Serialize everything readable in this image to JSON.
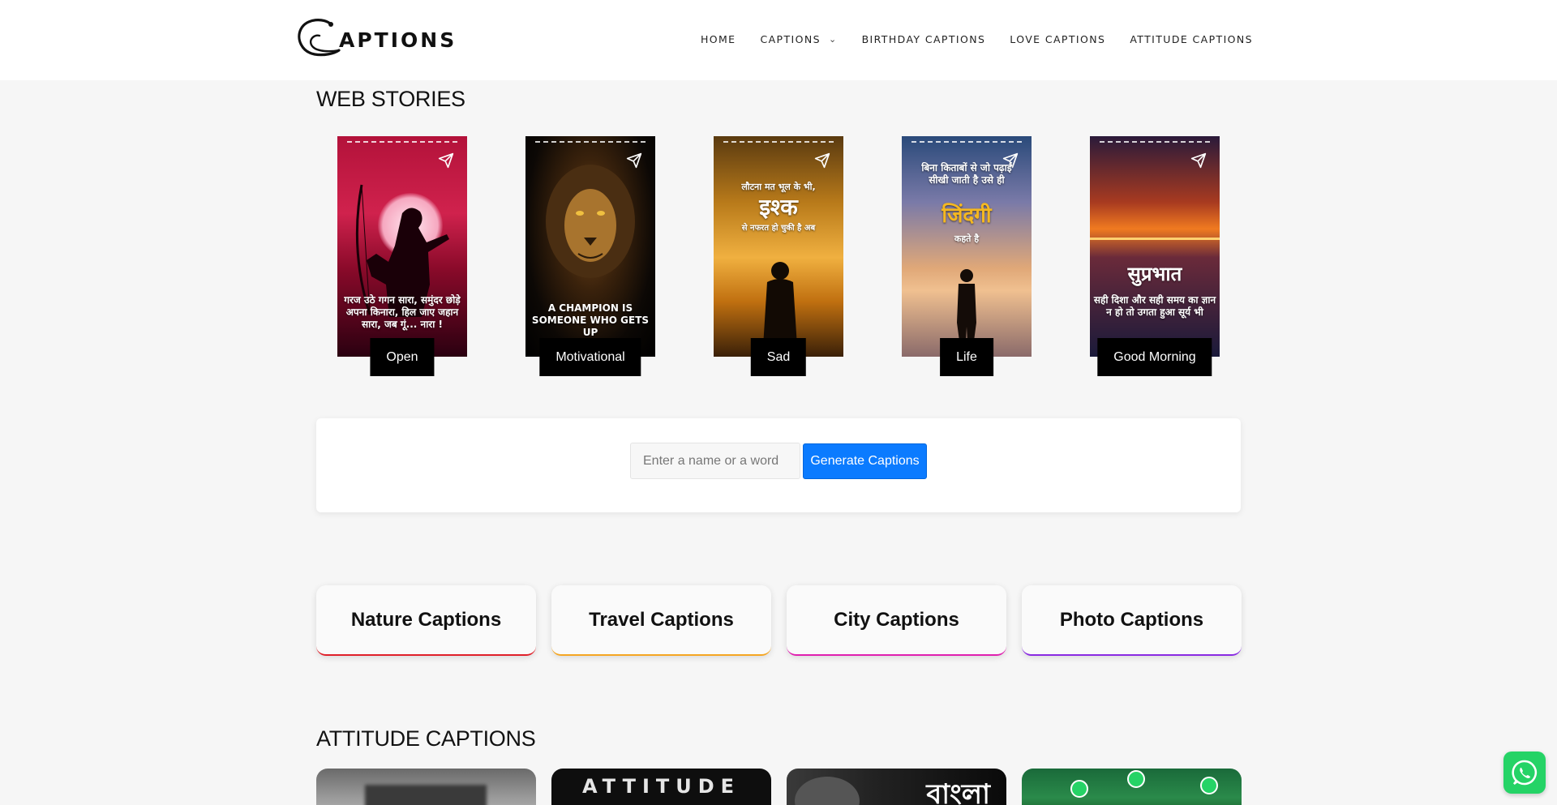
{
  "header": {
    "logo_text": "APTIONS",
    "nav": [
      {
        "label": "HOME"
      },
      {
        "label": "CAPTIONS",
        "has_dropdown": true
      },
      {
        "label": "BIRTHDAY CAPTIONS"
      },
      {
        "label": "LOVE CAPTIONS"
      },
      {
        "label": "ATTITUDE CAPTIONS"
      }
    ]
  },
  "web_stories": {
    "title": "WEB STORIES",
    "items": [
      {
        "label": "Open",
        "text": "गरज उठे गगन सारा, समुंदर छोड़े अपना किनारा, हिल जाए जहान सारा, जब गूं... नारा !"
      },
      {
        "label": "Motivational",
        "text": "A CHAMPION IS SOMEONE WHO GETS UP"
      },
      {
        "label": "Sad",
        "text_top": "लौटना मत भूल के भी,",
        "text_big": "इश्क",
        "text_bottom": "से नफरत हो चुकी है अब"
      },
      {
        "label": "Life",
        "text_top": "बिना किताबों से जो पढ़ाई सीखी जाती है उसे ही",
        "text_big": "जिंदगी",
        "text_bottom": "कहते है"
      },
      {
        "label": "Good Morning",
        "text_big": "सुप्रभात",
        "text_bottom": "सही दिशा और सही समय का ज्ञान न हो तो उगता हुआ सूर्य भी"
      }
    ]
  },
  "generator": {
    "placeholder": "Enter a name or a word",
    "button_label": "Generate Captions",
    "button_color": "#0b7bff"
  },
  "categories": [
    {
      "label": "Nature Captions",
      "accent": "#e0202a"
    },
    {
      "label": "Travel Captions",
      "accent": "#f5a623"
    },
    {
      "label": "City Captions",
      "accent": "#e020b0"
    },
    {
      "label": "Photo Captions",
      "accent": "#8a2be2"
    }
  ],
  "attitude": {
    "title": "ATTITUDE CAPTIONS",
    "thumb1_text": "ATTITUDE",
    "thumb2_text": "বাংলা"
  }
}
